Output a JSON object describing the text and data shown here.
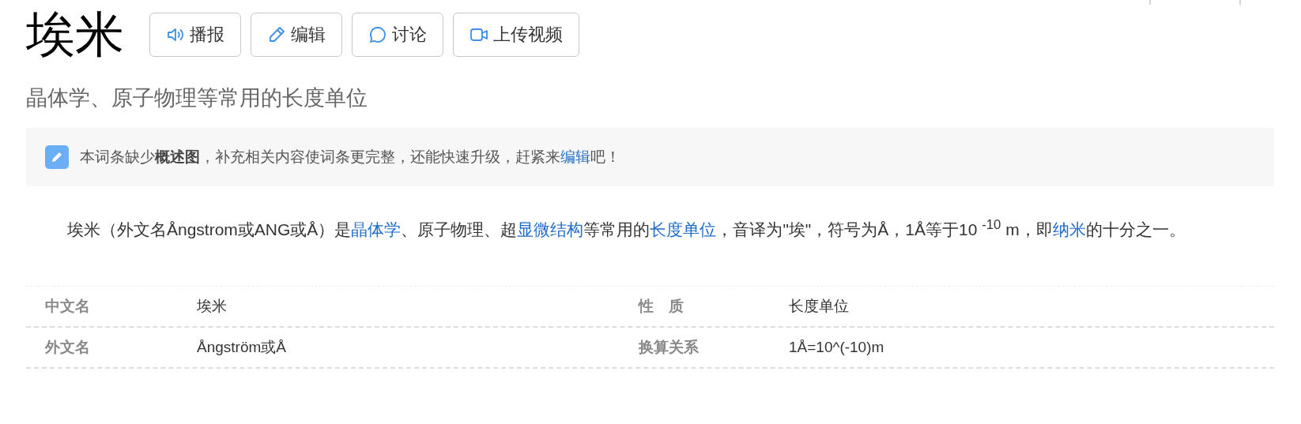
{
  "title": "埃米",
  "actions": [
    {
      "kind": "speaker",
      "label": "播报"
    },
    {
      "kind": "pencil",
      "label": "编辑"
    },
    {
      "kind": "chat",
      "label": "讨论"
    },
    {
      "kind": "video",
      "label": "上传视频"
    }
  ],
  "subtitle": "晶体学、原子物理等常用的长度单位",
  "notice": [
    {
      "kind": "text",
      "text": "本词条缺少"
    },
    {
      "kind": "bold",
      "text": "概述图"
    },
    {
      "kind": "text",
      "text": "，补充相关内容使词条更完整，还能快速升级，赶紧来"
    },
    {
      "kind": "link",
      "text": "编辑"
    },
    {
      "kind": "text",
      "text": "吧！"
    }
  ],
  "summary": [
    {
      "kind": "text",
      "text": "埃米（外文名Ångstrom或ANG或Å）是"
    },
    {
      "kind": "link",
      "text": "晶体学"
    },
    {
      "kind": "text",
      "text": "、原子物理、超"
    },
    {
      "kind": "link",
      "text": "显微结构"
    },
    {
      "kind": "text",
      "text": "等常用的"
    },
    {
      "kind": "link",
      "text": "长度单位"
    },
    {
      "kind": "text",
      "text": "，音译为\"埃\"，符号为Å，1Å等于10 "
    },
    {
      "kind": "sup",
      "text": "-10"
    },
    {
      "kind": "text",
      "text": " m，即"
    },
    {
      "kind": "link",
      "text": "纳米"
    },
    {
      "kind": "text",
      "text": "的十分之一。"
    }
  ],
  "basic_info": [
    [
      {
        "label": "中文名",
        "value": "埃米"
      },
      {
        "label": "性　质",
        "value": "长度单位"
      }
    ],
    [
      {
        "label": "外文名",
        "value": "Ångström或Å"
      },
      {
        "label": "换算关系",
        "value": "1Å=10^(-10)m"
      }
    ]
  ]
}
